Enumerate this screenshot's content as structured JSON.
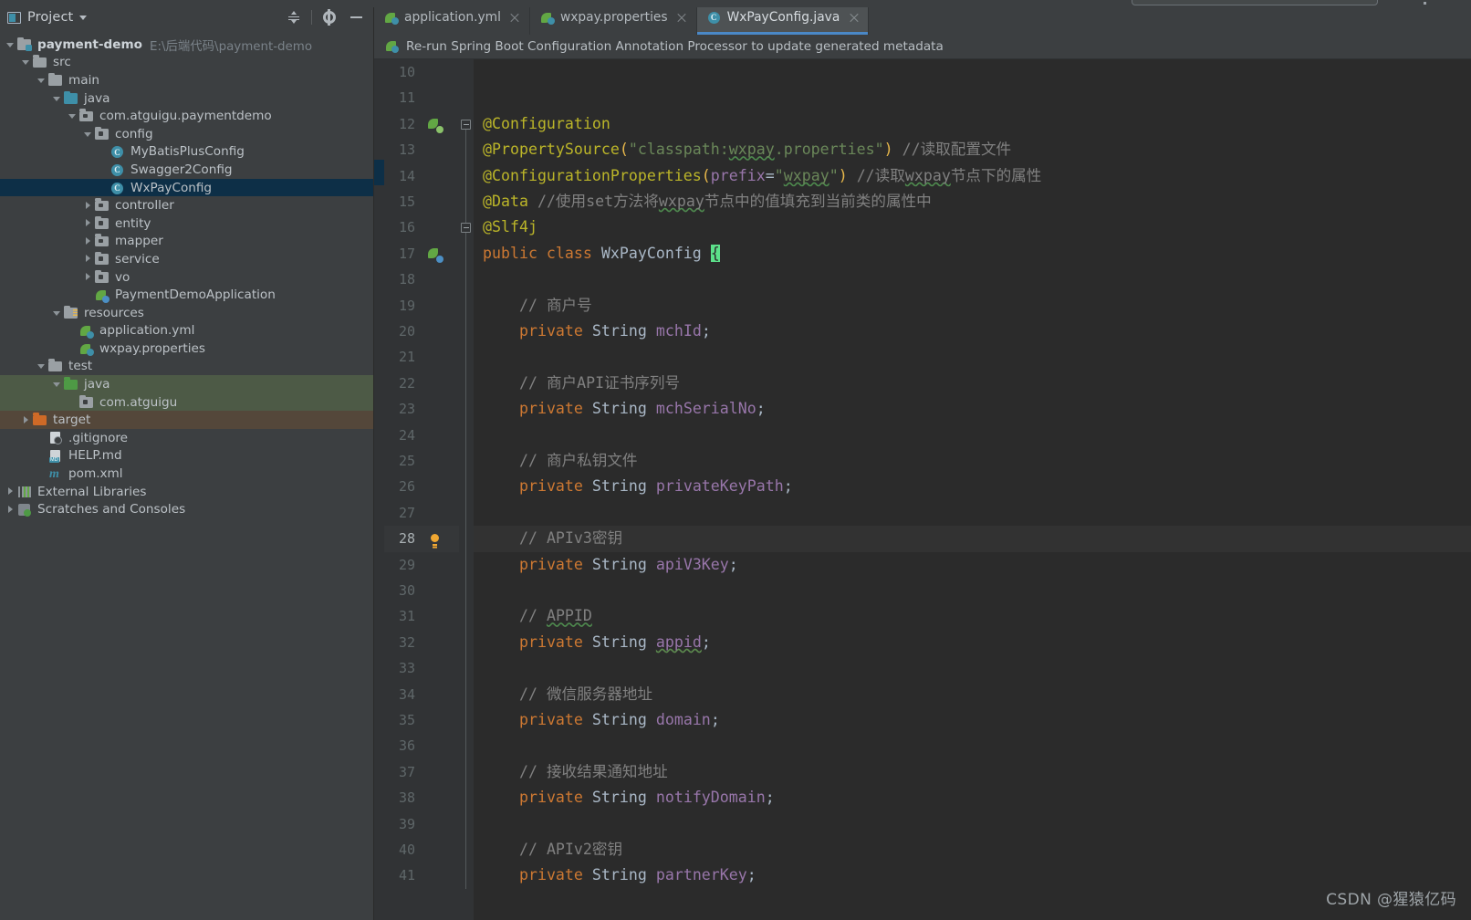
{
  "toolwindow": {
    "title": "Project",
    "icons": {
      "window": "project-window-icon",
      "caret": "chevron-down-icon",
      "collapse": "collapse-all-icon",
      "settings": "gear-icon",
      "hide": "minimize-icon"
    }
  },
  "tree": [
    {
      "label": "payment-demo",
      "path": "E:\\后端代码\\payment-demo",
      "indent": 0,
      "arrow": "down",
      "icon": "module-folder-icon",
      "bold": true,
      "state": ""
    },
    {
      "label": "src",
      "path": "",
      "indent": 1,
      "arrow": "down",
      "icon": "folder-grey-icon",
      "bold": false,
      "state": ""
    },
    {
      "label": "main",
      "path": "",
      "indent": 2,
      "arrow": "down",
      "icon": "folder-grey-icon",
      "bold": false,
      "state": ""
    },
    {
      "label": "java",
      "path": "",
      "indent": 3,
      "arrow": "down",
      "icon": "folder-source-icon",
      "bold": false,
      "state": ""
    },
    {
      "label": "com.atguigu.paymentdemo",
      "path": "",
      "indent": 4,
      "arrow": "down",
      "icon": "package-icon",
      "bold": false,
      "state": ""
    },
    {
      "label": "config",
      "path": "",
      "indent": 5,
      "arrow": "down",
      "icon": "package-icon",
      "bold": false,
      "state": ""
    },
    {
      "label": "MyBatisPlusConfig",
      "path": "",
      "indent": 6,
      "arrow": "none",
      "icon": "java-class-icon",
      "bold": false,
      "state": ""
    },
    {
      "label": "Swagger2Config",
      "path": "",
      "indent": 6,
      "arrow": "none",
      "icon": "java-class-icon",
      "bold": false,
      "state": ""
    },
    {
      "label": "WxPayConfig",
      "path": "",
      "indent": 6,
      "arrow": "none",
      "icon": "java-class-icon",
      "bold": false,
      "state": "selected"
    },
    {
      "label": "controller",
      "path": "",
      "indent": 5,
      "arrow": "right",
      "icon": "package-icon",
      "bold": false,
      "state": ""
    },
    {
      "label": "entity",
      "path": "",
      "indent": 5,
      "arrow": "right",
      "icon": "package-icon",
      "bold": false,
      "state": ""
    },
    {
      "label": "mapper",
      "path": "",
      "indent": 5,
      "arrow": "right",
      "icon": "package-icon",
      "bold": false,
      "state": ""
    },
    {
      "label": "service",
      "path": "",
      "indent": 5,
      "arrow": "right",
      "icon": "package-icon",
      "bold": false,
      "state": ""
    },
    {
      "label": "vo",
      "path": "",
      "indent": 5,
      "arrow": "right",
      "icon": "package-icon",
      "bold": false,
      "state": ""
    },
    {
      "label": "PaymentDemoApplication",
      "path": "",
      "indent": 5,
      "arrow": "none",
      "icon": "spring-boot-run-icon",
      "bold": false,
      "state": ""
    },
    {
      "label": "resources",
      "path": "",
      "indent": 3,
      "arrow": "down",
      "icon": "folder-resources-icon",
      "bold": false,
      "state": ""
    },
    {
      "label": "application.yml",
      "path": "",
      "indent": 4,
      "arrow": "none",
      "icon": "spring-yaml-icon",
      "bold": false,
      "state": ""
    },
    {
      "label": "wxpay.properties",
      "path": "",
      "indent": 4,
      "arrow": "none",
      "icon": "spring-properties-icon",
      "bold": false,
      "state": ""
    },
    {
      "label": "test",
      "path": "",
      "indent": 2,
      "arrow": "down",
      "icon": "folder-grey-icon",
      "bold": false,
      "state": ""
    },
    {
      "label": "java",
      "path": "",
      "indent": 3,
      "arrow": "down",
      "icon": "folder-test-source-icon",
      "bold": false,
      "state": "green"
    },
    {
      "label": "com.atguigu",
      "path": "",
      "indent": 4,
      "arrow": "none",
      "icon": "package-icon",
      "bold": false,
      "state": "green"
    },
    {
      "label": "target",
      "path": "",
      "indent": 1,
      "arrow": "right",
      "icon": "folder-excluded-icon",
      "bold": false,
      "state": "brown"
    },
    {
      "label": ".gitignore",
      "path": "",
      "indent": 2,
      "arrow": "none",
      "icon": "gitignore-file-icon",
      "bold": false,
      "state": ""
    },
    {
      "label": "HELP.md",
      "path": "",
      "indent": 2,
      "arrow": "none",
      "icon": "markdown-file-icon",
      "bold": false,
      "state": ""
    },
    {
      "label": "pom.xml",
      "path": "",
      "indent": 2,
      "arrow": "none",
      "icon": "maven-pom-icon",
      "bold": false,
      "state": ""
    },
    {
      "label": "External Libraries",
      "path": "",
      "indent": 0,
      "arrow": "right",
      "icon": "external-libraries-icon",
      "bold": false,
      "state": ""
    },
    {
      "label": "Scratches and Consoles",
      "path": "",
      "indent": 0,
      "arrow": "right",
      "icon": "scratches-icon",
      "bold": false,
      "state": ""
    }
  ],
  "tabs": [
    {
      "label": "application.yml",
      "icon": "spring-yaml-icon",
      "active": false
    },
    {
      "label": "wxpay.properties",
      "icon": "spring-properties-icon",
      "active": false
    },
    {
      "label": "WxPayConfig.java",
      "icon": "java-class-icon",
      "active": true
    }
  ],
  "notification": {
    "icon": "spring-boot-icon",
    "text": "Re-run Spring Boot Configuration Annotation Processor to update generated metadata"
  },
  "editor": {
    "first_line": 10,
    "last_line": 41,
    "current_line": 28,
    "caret_line": 17,
    "lines": [
      {
        "n": 10,
        "text": ""
      },
      {
        "n": 11,
        "text": ""
      },
      {
        "n": 12,
        "text": "@Configuration"
      },
      {
        "n": 13,
        "text": "@PropertySource(\"classpath:wxpay.properties\") //读取配置文件"
      },
      {
        "n": 14,
        "text": "@ConfigurationProperties(prefix=\"wxpay\") //读取wxpay节点下的属性"
      },
      {
        "n": 15,
        "text": "@Data //使用set方法将wxpay节点中的值填充到当前类的属性中"
      },
      {
        "n": 16,
        "text": "@Slf4j"
      },
      {
        "n": 17,
        "text": "public class WxPayConfig {"
      },
      {
        "n": 18,
        "text": ""
      },
      {
        "n": 19,
        "text": "    // 商户号"
      },
      {
        "n": 20,
        "text": "    private String mchId;"
      },
      {
        "n": 21,
        "text": ""
      },
      {
        "n": 22,
        "text": "    // 商户API证书序列号"
      },
      {
        "n": 23,
        "text": "    private String mchSerialNo;"
      },
      {
        "n": 24,
        "text": ""
      },
      {
        "n": 25,
        "text": "    // 商户私钥文件"
      },
      {
        "n": 26,
        "text": "    private String privateKeyPath;"
      },
      {
        "n": 27,
        "text": ""
      },
      {
        "n": 28,
        "text": "    // APIv3密钥"
      },
      {
        "n": 29,
        "text": "    private String apiV3Key;"
      },
      {
        "n": 30,
        "text": ""
      },
      {
        "n": 31,
        "text": "    // APPID"
      },
      {
        "n": 32,
        "text": "    private String appid;"
      },
      {
        "n": 33,
        "text": ""
      },
      {
        "n": 34,
        "text": "    // 微信服务器地址"
      },
      {
        "n": 35,
        "text": "    private String domain;"
      },
      {
        "n": 36,
        "text": ""
      },
      {
        "n": 37,
        "text": "    // 接收结果通知地址"
      },
      {
        "n": 38,
        "text": "    private String notifyDomain;"
      },
      {
        "n": 39,
        "text": ""
      },
      {
        "n": 40,
        "text": "    // APIv2密钥"
      },
      {
        "n": 41,
        "text": "    private String partnerKey;"
      }
    ],
    "gutter_icons": [
      {
        "line": 12,
        "icon": "spring-bean-icon"
      },
      {
        "line": 17,
        "icon": "spring-bean-config-icon"
      },
      {
        "line": 28,
        "icon": "intention-bulb-icon"
      }
    ]
  },
  "watermark": "CSDN @猩猿亿码",
  "colors": {
    "selection": "#0d2f47",
    "test_source": "#4d5a46",
    "excluded": "#54473a",
    "tab_underline": "#4a88c7",
    "annotation": "#bbb529",
    "keyword": "#cc7832",
    "field": "#9876aa",
    "string": "#6a8759",
    "comment": "#808080",
    "editor_bg": "#2b2b2b",
    "panel_bg": "#3c3f41"
  }
}
